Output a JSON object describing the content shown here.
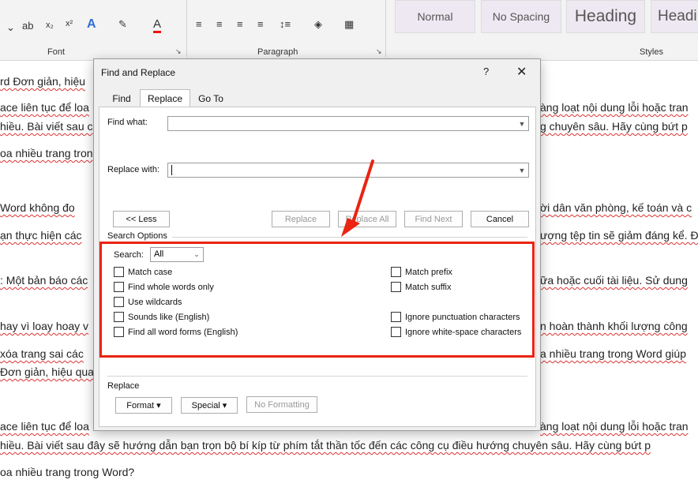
{
  "ribbon": {
    "font_group": "Font",
    "paragraph_group": "Paragraph",
    "styles_group": "Styles",
    "styles": [
      "Normal",
      "No Spacing",
      "Heading",
      "Headi"
    ]
  },
  "document": {
    "left_lines": [
      "rd Đơn giản, hiệu",
      "ace liên tục để loa",
      "hiều. Bài viết sau c",
      "oa nhiều trang tron",
      "Word không đo",
      "ạn thực hiện các",
      ": Một bản báo các",
      "hay vì loay hoay v",
      "xóa trang sai các",
      "Đơn giản, hiệu qua",
      "ace liên tục để loa",
      "hiều. Bài viết sau đây sẽ hướng dẫn bạn trọn bộ bí kíp từ phím tắt thần tốc đến các công cụ điều hướng chuyên sâu. Hãy cùng bứt p",
      "oa nhiều trang trong Word?"
    ],
    "right_lines": [
      "àng loạt nội dung lỗi hoặc tran",
      "g chuyên sâu. Hãy cùng bứt p",
      "ời dân văn phòng, kế toán và c",
      "ượng tệp tin sẽ giảm đáng kể. Đ",
      "ữa hoặc cuối tài liệu. Sử dung",
      "n hoàn thành khối lượng công",
      "a nhiều trang trong Word giúp",
      "àng loạt nội dung lỗi hoặc tran"
    ]
  },
  "dialog": {
    "title": "Find and Replace",
    "help": "?",
    "close": "✕",
    "tabs": [
      "Find",
      "Replace",
      "Go To"
    ],
    "find_what_label": "Find what:",
    "find_what_value": "",
    "replace_with_label": "Replace with:",
    "replace_with_value": "",
    "buttons": {
      "less": "<< Less",
      "replace": "Replace",
      "replace_all": "Replace All",
      "find_next": "Find Next",
      "cancel": "Cancel"
    },
    "search_options_label": "Search Options",
    "search_label": "Search:",
    "search_value": "All",
    "options_left": [
      "Match case",
      "Find whole words only",
      "Use wildcards",
      "Sounds like (English)",
      "Find all word forms (English)"
    ],
    "options_right": [
      "Match prefix",
      "Match suffix",
      "Ignore punctuation characters",
      "Ignore white-space characters"
    ],
    "replace_section_label": "Replace",
    "format_button": "Format ▾",
    "special_button": "Special ▾",
    "no_formatting_button": "No Formatting"
  },
  "colors": {
    "highlight": "#ea2412",
    "dialog_bg": "#f0f0f0",
    "style_gallery": "#ede8f2"
  }
}
